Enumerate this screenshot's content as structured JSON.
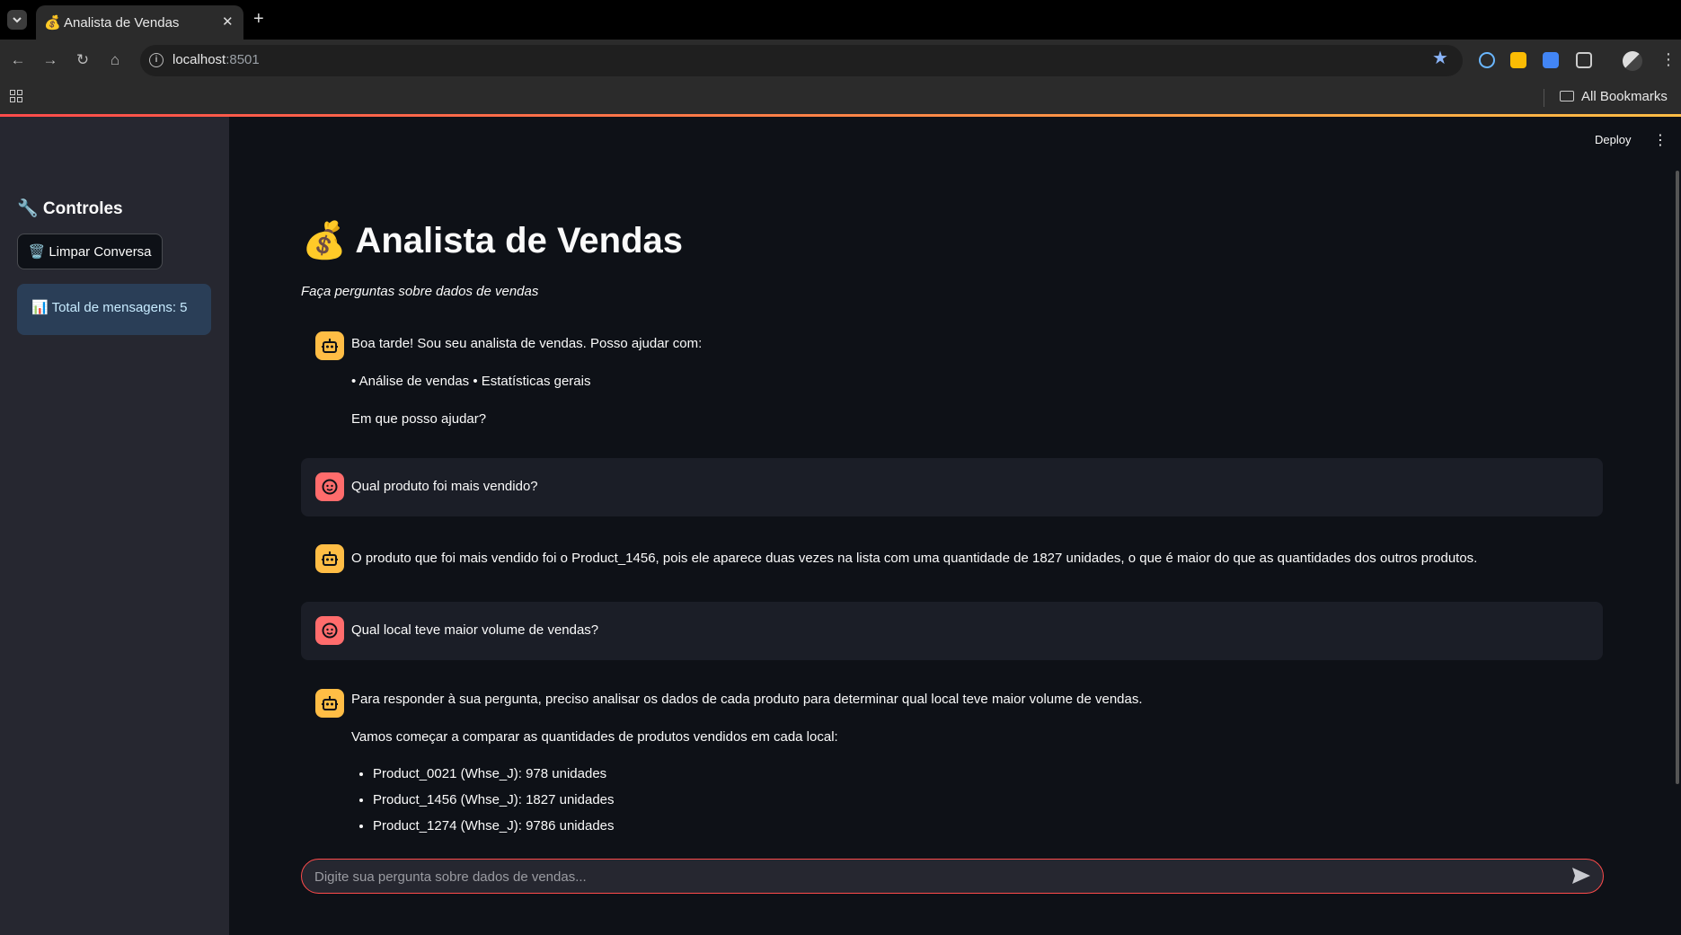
{
  "browser": {
    "tab_favicon": "💰",
    "tab_title": "Analista de Vendas",
    "url_host": "localhost",
    "url_port": ":8501",
    "bookmarks_label": "All Bookmarks"
  },
  "header": {
    "deploy_label": "Deploy"
  },
  "sidebar": {
    "title": "🔧 Controles",
    "clear_button": "🗑️ Limpar Conversa",
    "message_count": "📊 Total de mensagens: 5"
  },
  "page": {
    "title": "💰 Analista de Vendas",
    "caption": "Faça perguntas sobre dados de vendas"
  },
  "messages": [
    {
      "role": "assistant",
      "lines": [
        "Boa tarde! Sou seu analista de vendas. Posso ajudar com:",
        "• Análise de vendas • Estatísticas gerais",
        "Em que posso ajudar?"
      ]
    },
    {
      "role": "user",
      "text": "Qual produto foi mais vendido?"
    },
    {
      "role": "assistant",
      "text": "O produto que foi mais vendido foi o Product_1456, pois ele aparece duas vezes na lista com uma quantidade de 1827 unidades, o que é maior do que as quantidades dos outros produtos."
    },
    {
      "role": "user",
      "text": "Qual local teve maior volume de vendas?"
    },
    {
      "role": "assistant",
      "lines": [
        "Para responder à sua pergunta, preciso analisar os dados de cada produto para determinar qual local teve maior volume de vendas.",
        "Vamos começar a comparar as quantidades de produtos vendidos em cada local:"
      ],
      "bullets": [
        "Product_0021 (Whse_J): 978 unidades",
        "Product_1456 (Whse_J): 1827 unidades",
        "Product_1274 (Whse_J): 9786 unidades"
      ]
    }
  ],
  "chat_input": {
    "placeholder": "Digite sua pergunta sobre dados de vendas..."
  },
  "colors": {
    "accent": "#ff4b4b",
    "assistant_avatar": "#ffbd45",
    "user_avatar": "#ff6c6c",
    "background": "#0e1117",
    "sidebar": "#262730"
  }
}
